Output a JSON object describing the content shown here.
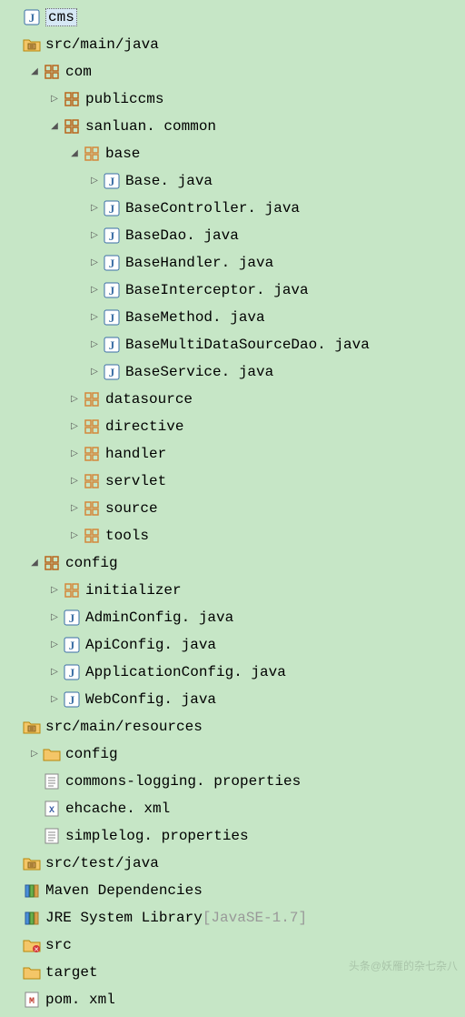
{
  "tree": [
    {
      "indent": 8,
      "arrow": "none",
      "icon": "java",
      "label": "cms",
      "selected": true
    },
    {
      "indent": 8,
      "arrow": "none",
      "icon": "srcfolder",
      "label": "src/main/java"
    },
    {
      "indent": 30,
      "arrow": "open",
      "icon": "package",
      "label": "com"
    },
    {
      "indent": 52,
      "arrow": "closed",
      "icon": "package",
      "label": "publiccms"
    },
    {
      "indent": 52,
      "arrow": "open",
      "icon": "package",
      "label": "sanluan. common"
    },
    {
      "indent": 74,
      "arrow": "open",
      "icon": "package-o",
      "label": "base"
    },
    {
      "indent": 96,
      "arrow": "closed",
      "icon": "java",
      "label": "Base. java"
    },
    {
      "indent": 96,
      "arrow": "closed",
      "icon": "java",
      "label": "BaseController. java"
    },
    {
      "indent": 96,
      "arrow": "closed",
      "icon": "java",
      "label": "BaseDao. java"
    },
    {
      "indent": 96,
      "arrow": "closed",
      "icon": "java",
      "label": "BaseHandler. java"
    },
    {
      "indent": 96,
      "arrow": "closed",
      "icon": "java",
      "label": "BaseInterceptor. java"
    },
    {
      "indent": 96,
      "arrow": "closed",
      "icon": "java",
      "label": "BaseMethod. java"
    },
    {
      "indent": 96,
      "arrow": "closed",
      "icon": "java",
      "label": "BaseMultiDataSourceDao. java"
    },
    {
      "indent": 96,
      "arrow": "closed",
      "icon": "java",
      "label": "BaseService. java"
    },
    {
      "indent": 74,
      "arrow": "closed",
      "icon": "package-o",
      "label": "datasource"
    },
    {
      "indent": 74,
      "arrow": "closed",
      "icon": "package-o",
      "label": "directive"
    },
    {
      "indent": 74,
      "arrow": "closed",
      "icon": "package-o",
      "label": "handler"
    },
    {
      "indent": 74,
      "arrow": "closed",
      "icon": "package-o",
      "label": "servlet"
    },
    {
      "indent": 74,
      "arrow": "closed",
      "icon": "package-o",
      "label": "source"
    },
    {
      "indent": 74,
      "arrow": "closed",
      "icon": "package-o",
      "label": "tools"
    },
    {
      "indent": 30,
      "arrow": "open",
      "icon": "package",
      "label": "config"
    },
    {
      "indent": 52,
      "arrow": "closed",
      "icon": "package-o",
      "label": "initializer"
    },
    {
      "indent": 52,
      "arrow": "closed",
      "icon": "java",
      "label": "AdminConfig. java"
    },
    {
      "indent": 52,
      "arrow": "closed",
      "icon": "java",
      "label": "ApiConfig. java"
    },
    {
      "indent": 52,
      "arrow": "closed",
      "icon": "java",
      "label": "ApplicationConfig. java"
    },
    {
      "indent": 52,
      "arrow": "closed",
      "icon": "java",
      "label": "WebConfig. java"
    },
    {
      "indent": 8,
      "arrow": "none",
      "icon": "srcfolder",
      "label": "src/main/resources"
    },
    {
      "indent": 30,
      "arrow": "closed",
      "icon": "folder",
      "label": "config"
    },
    {
      "indent": 30,
      "arrow": "none",
      "icon": "props",
      "label": "commons-logging. properties"
    },
    {
      "indent": 30,
      "arrow": "none",
      "icon": "xml",
      "label": "ehcache. xml"
    },
    {
      "indent": 30,
      "arrow": "none",
      "icon": "props",
      "label": "simplelog. properties"
    },
    {
      "indent": 8,
      "arrow": "none",
      "icon": "srcfolder",
      "label": "src/test/java"
    },
    {
      "indent": 8,
      "arrow": "none",
      "icon": "library",
      "label": "Maven Dependencies"
    },
    {
      "indent": 8,
      "arrow": "none",
      "icon": "library",
      "label": "JRE System Library",
      "suffix": " [JavaSE-1.7]"
    },
    {
      "indent": 8,
      "arrow": "none",
      "icon": "folder-err",
      "label": "src"
    },
    {
      "indent": 8,
      "arrow": "none",
      "icon": "folder",
      "label": "target"
    },
    {
      "indent": 8,
      "arrow": "none",
      "icon": "maven",
      "label": "pom. xml"
    }
  ],
  "watermark": "头条@妖雁的杂七杂八"
}
